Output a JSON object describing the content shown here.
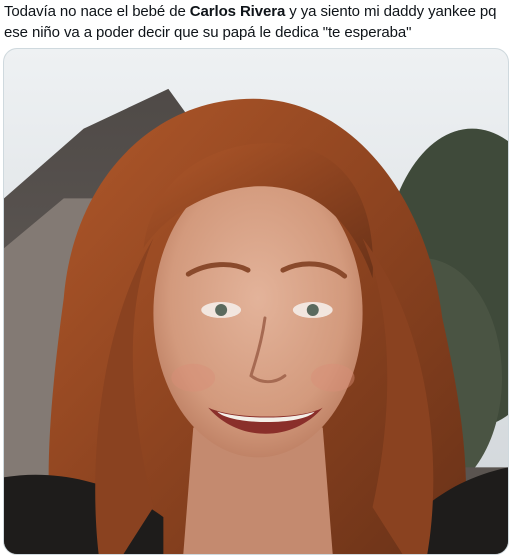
{
  "post": {
    "text_before": "Todavía no nace el bebé de ",
    "text_bold": "Carlos Rivera",
    "text_after": " y ya siento mi daddy yankee pq ese niño va a poder decir que su papá le dedica \"te esperaba\""
  },
  "media": {
    "icon": "photo-icon"
  },
  "colors": {
    "text": "#0f1419",
    "border": "#cfd9de",
    "sky": "#e3e7ea",
    "hair": "#9a4a22",
    "skin": "#d9a58a",
    "foliage": "#3c4836"
  }
}
